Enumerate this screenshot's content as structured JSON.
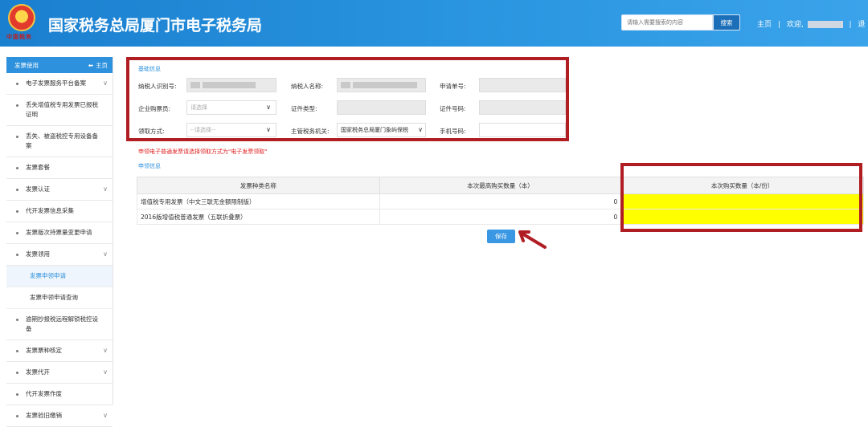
{
  "header": {
    "emblem_text": "中国税务",
    "title": "国家税务总局厦门市电子税务局",
    "search_placeholder": "请输入需要搜索的内容",
    "search_button": "搜索",
    "home_link": "主页",
    "sep": "|",
    "welcome": "欢迎,",
    "exit_partial": "退"
  },
  "sidebar": {
    "header_label": "发票使用",
    "home_label": "主页",
    "items": [
      {
        "label": "电子发票服务平台备案",
        "chevron": true
      },
      {
        "label": "丢失增值税专用发票已报税证明",
        "chevron": false
      },
      {
        "label": "丢失、被盗税控专用设备备案",
        "chevron": false
      },
      {
        "label": "发票套餐",
        "chevron": false
      },
      {
        "label": "发票认证",
        "chevron": true
      },
      {
        "label": "代开发票信息采集",
        "chevron": false
      },
      {
        "label": "发票版次持票量变更申请",
        "chevron": false
      },
      {
        "label": "发票领用",
        "chevron": true
      }
    ],
    "subitems": [
      {
        "label": "发票申领申请",
        "active": true
      },
      {
        "label": "发票申领申请查询",
        "active": false
      }
    ],
    "items_after": [
      {
        "label": "逾期抄报税远程解锁税控设备",
        "chevron": false
      },
      {
        "label": "发票票种核定",
        "chevron": true
      },
      {
        "label": "发票代开",
        "chevron": true
      },
      {
        "label": "代开发票作废",
        "chevron": false
      },
      {
        "label": "发票验旧缴销",
        "chevron": true
      }
    ]
  },
  "basic_info": {
    "title": "基础信息",
    "taxpayer_id_label": "纳税人识别号:",
    "taxpayer_name_label": "纳税人名称:",
    "application_no_label": "申请单号:",
    "buyer_label": "企业购票员:",
    "buyer_placeholder": "请选择",
    "cert_type_label": "证件类型:",
    "cert_no_label": "证件号码:",
    "pickup_label": "领取方式:",
    "pickup_placeholder": "--请选择--",
    "tax_authority_label": "主管税务机关:",
    "tax_authority_value": "国家税务总局厦门象屿保税",
    "phone_label": "手机号码:"
  },
  "notice": "申领电子普通发票请选择领取方式为\"电子发票领取\"",
  "apply_info": {
    "title": "申领信息",
    "columns": [
      "发票种类名称",
      "本次最高购买数量（本）",
      "本次购买数量（本/份）"
    ],
    "rows": [
      {
        "name": "增值税专用发票（中文三联无金额限制版）",
        "max": "0",
        "qty": ""
      },
      {
        "name": "2016版增值税普通发票（五联折叠票）",
        "max": "0",
        "qty": ""
      }
    ]
  },
  "save_button": "保存",
  "colors": {
    "header_blue": "#2a95e0",
    "accent_blue": "#2d91dd",
    "highlight_red": "#b01e23",
    "highlight_yellow": "#ffff00",
    "notice_red": "#e02020"
  }
}
